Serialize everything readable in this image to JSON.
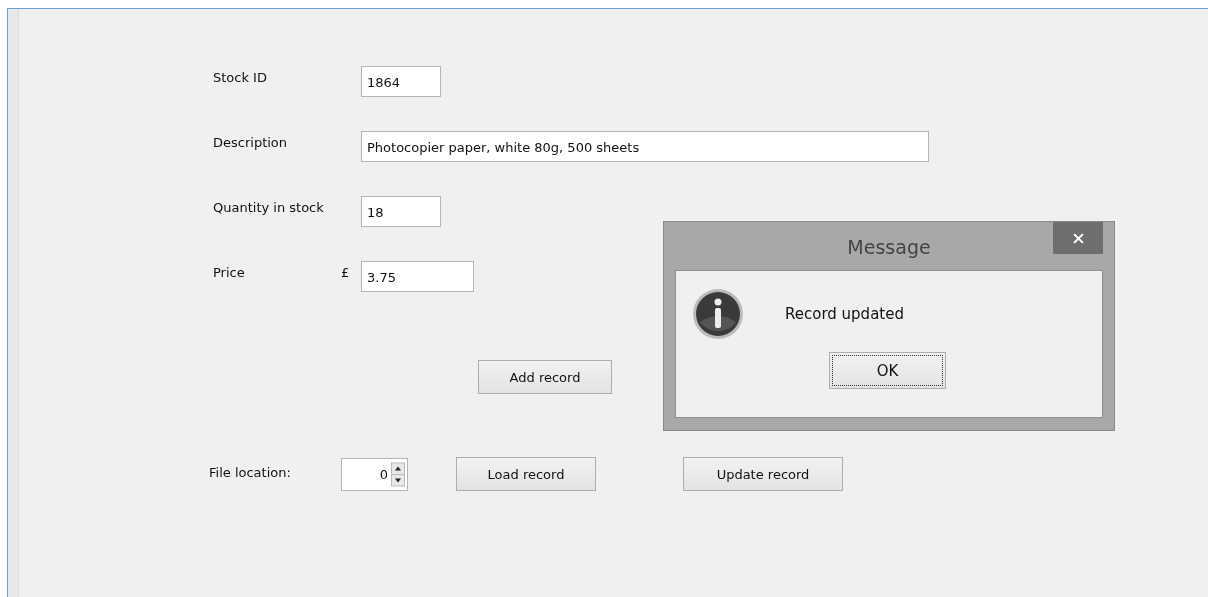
{
  "form": {
    "fields": [
      {
        "label": "Stock ID",
        "value": "1864"
      },
      {
        "label": "Description",
        "value": "Photocopier paper, white 80g, 500 sheets"
      },
      {
        "label": "Quantity in stock",
        "value": "18"
      },
      {
        "label": "Price",
        "prefix": "£",
        "value": "3.75"
      }
    ],
    "add_button": "Add record",
    "file_location": {
      "label": "File location:",
      "value": "0"
    },
    "load_button": "Load record",
    "update_button": "Update record"
  },
  "dialog": {
    "title": "Message",
    "message": "Record updated",
    "ok_button": "OK"
  }
}
